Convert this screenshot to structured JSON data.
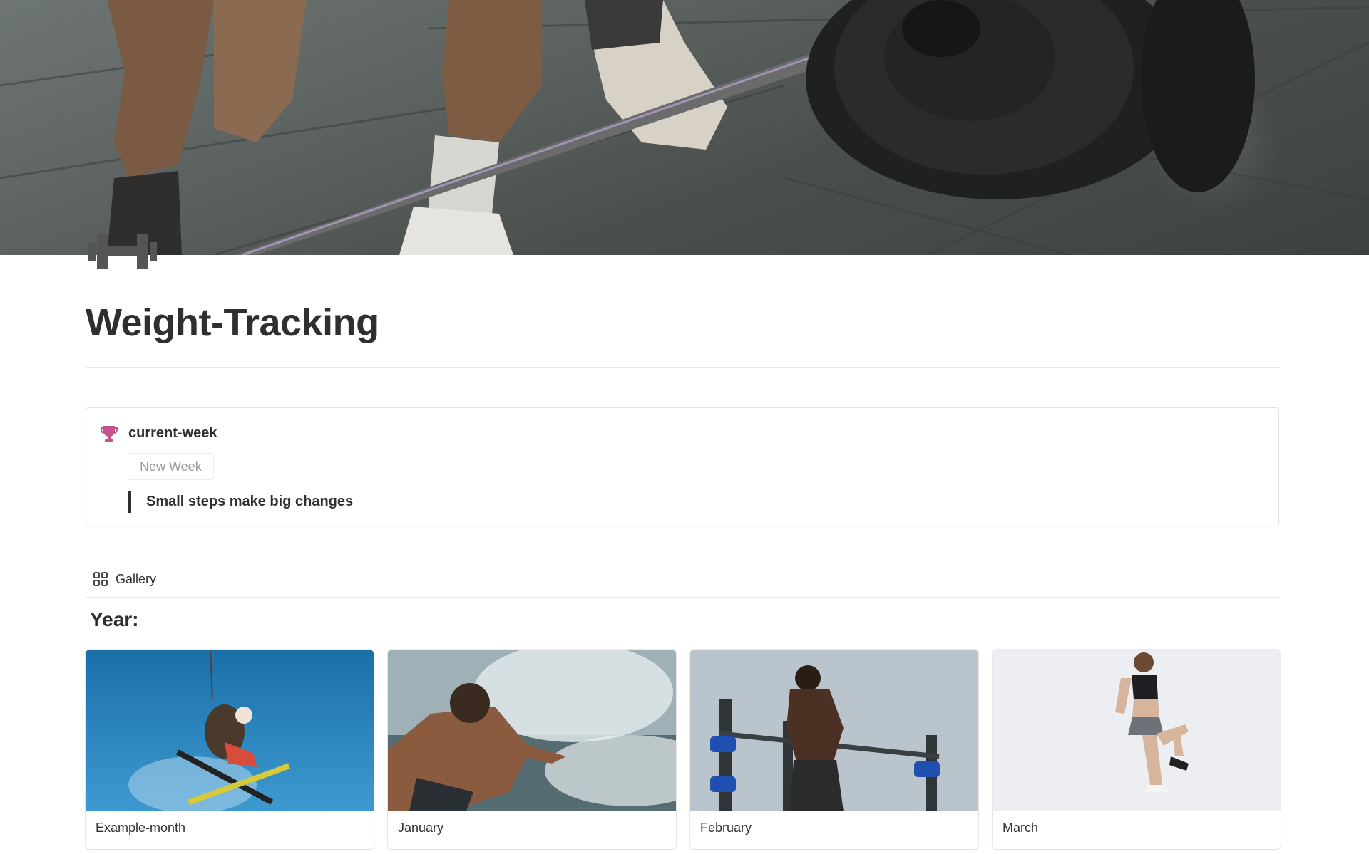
{
  "page": {
    "title": "Weight-Tracking",
    "icon": "dumbbell-icon"
  },
  "callout": {
    "icon": "trophy-icon",
    "title": "current-week",
    "button_label": "New Week",
    "quote": "Small steps make big changes",
    "icon_color": "#c4528c"
  },
  "view": {
    "tab_icon": "gallery-grid-icon",
    "tab_label": "Gallery"
  },
  "gallery": {
    "group_label": "Year:",
    "cards": [
      {
        "label": "Example-month",
        "image": "skier-jump-photo"
      },
      {
        "label": "January",
        "image": "surfer-splash-photo"
      },
      {
        "label": "February",
        "image": "bar-dips-photo"
      },
      {
        "label": "March",
        "image": "high-knee-photo"
      }
    ]
  }
}
